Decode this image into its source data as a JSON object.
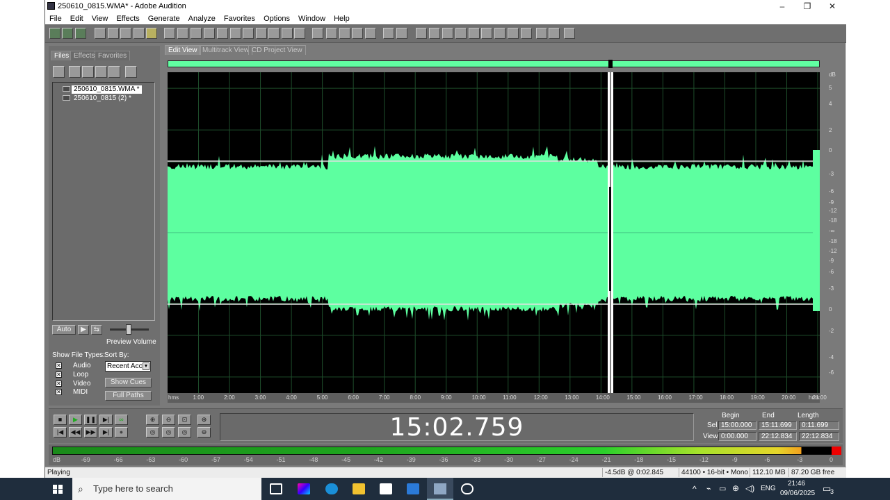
{
  "window": {
    "title": "250610_0815.WMA* - Adobe Audition",
    "minimize": "–",
    "maximize": "❐",
    "close": "✕"
  },
  "menu": [
    "File",
    "Edit",
    "View",
    "Effects",
    "Generate",
    "Analyze",
    "Favorites",
    "Options",
    "Window",
    "Help"
  ],
  "panel": {
    "tabs": [
      "Files",
      "Effects",
      "Favorites"
    ],
    "files": [
      "250610_0815.WMA *",
      "250610_0815 (2) *"
    ],
    "auto_label": "Auto",
    "preview_volume_label": "Preview Volume",
    "show_file_types_label": "Show File Types:",
    "file_types": [
      {
        "label": "Audio",
        "checked": "✕"
      },
      {
        "label": "Loop",
        "checked": "✕"
      },
      {
        "label": "Video",
        "checked": "✕"
      },
      {
        "label": "MIDI",
        "checked": "✕"
      }
    ],
    "sort_by_label": "Sort By:",
    "sort_value": "Recent Acce",
    "show_cues_label": "Show Cues",
    "full_paths_label": "Full Paths"
  },
  "views": {
    "tabs": [
      "Edit View",
      "Multitrack View",
      "CD Project View"
    ],
    "active": "Edit View"
  },
  "waveform": {
    "color": "#5dffa0",
    "background": "#000000",
    "time_ticks": [
      "hms",
      "1:00",
      "2:00",
      "3:00",
      "4:00",
      "5:00",
      "6:00",
      "7:00",
      "8:00",
      "9:00",
      "10:00",
      "11:00",
      "12:00",
      "13:00",
      "14:00",
      "15:00",
      "16:00",
      "17:00",
      "18:00",
      "19:00",
      "20:00",
      "21:00",
      "hms"
    ],
    "db_ticks": [
      "dB",
      "5",
      "4",
      "2",
      "0",
      "-3",
      "-6",
      "-9",
      "-12",
      "-18",
      "-∞",
      "-18",
      "-12",
      "-9",
      "-6",
      "-3",
      "0",
      "-2",
      "-4",
      "-6"
    ],
    "playhead_time": "15:00"
  },
  "transport": {
    "current_time": "15:02.759",
    "begin_label": "Begin",
    "end_label": "End",
    "length_label": "Length",
    "sel_label": "Sel",
    "view_label": "View",
    "sel": {
      "begin": "15:00.000",
      "end": "15:11.699",
      "length": "0:11.699"
    },
    "view": {
      "begin": "0:00.000",
      "end": "22:12.834",
      "length": "22:12.834"
    }
  },
  "meter": {
    "ticks": [
      "dB",
      "-69",
      "-66",
      "-63",
      "-60",
      "-57",
      "-54",
      "-51",
      "-48",
      "-45",
      "-42",
      "-39",
      "-36",
      "-33",
      "-30",
      "-27",
      "-24",
      "-21",
      "-18",
      "-15",
      "-12",
      "-9",
      "-6",
      "-3",
      "0"
    ]
  },
  "status": {
    "state": "Playing",
    "level": "-4.5dB @   0:02.845",
    "format": "44100 • 16-bit • Mono",
    "size": "112.10 MB",
    "free": "87.20 GB free"
  },
  "taskbar": {
    "search_placeholder": "Type here to search",
    "lang": "ENG",
    "time": "21:46",
    "date": "09/06/2025",
    "notif_count": "3"
  }
}
